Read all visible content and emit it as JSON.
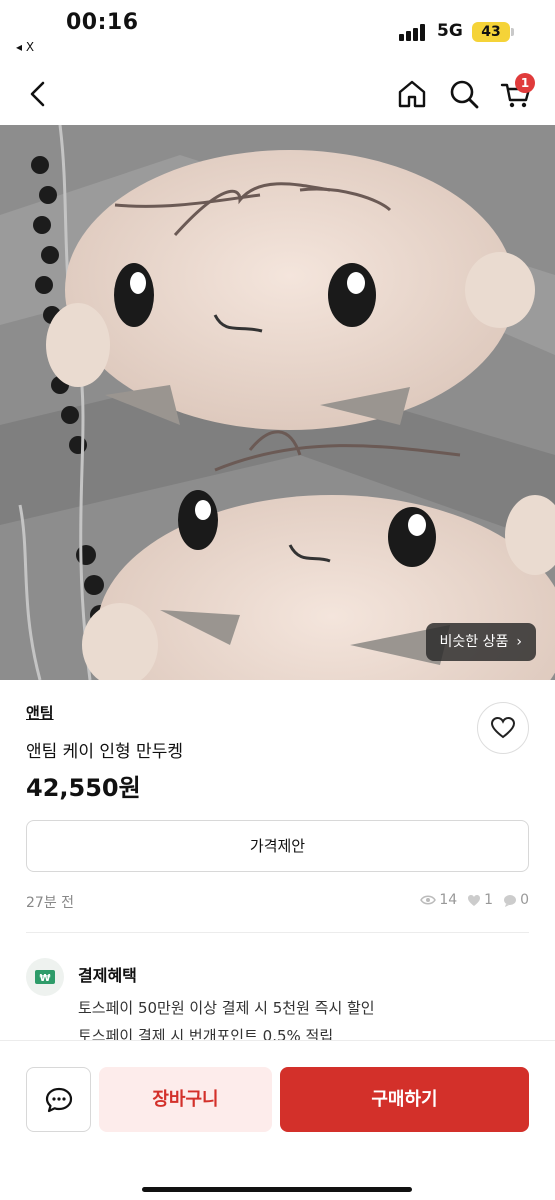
{
  "status_bar": {
    "time": "00:16",
    "back_app": "◂ X",
    "network": "5G",
    "battery": "43"
  },
  "nav": {
    "cart_badge": "1",
    "icons": [
      "back-arrow-icon",
      "home-icon",
      "search-icon",
      "cart-icon"
    ]
  },
  "product": {
    "image_alt": "plush dumpling toys",
    "similar_label": "비슷한 상품",
    "store_name": "앤팀",
    "title": "앤팀 케이 인형 만두켕",
    "price": "42,550원",
    "offer_label": "가격제안",
    "posted_time": "27분 전",
    "views": "14",
    "likes": "1",
    "chats": "0"
  },
  "benefits": {
    "title": "결제혜택",
    "lines": [
      "토스페이 50만원 이상 결제 시 5천원 즉시 할인",
      "토스페이 결제 시 번개포인트 0.5% 적립"
    ]
  },
  "actions": {
    "cart_label": "장바구니",
    "buy_label": "구매하기"
  },
  "colors": {
    "accent": "#d3302a",
    "accent_light": "#fdeceb",
    "badge": "#e03b3b"
  }
}
